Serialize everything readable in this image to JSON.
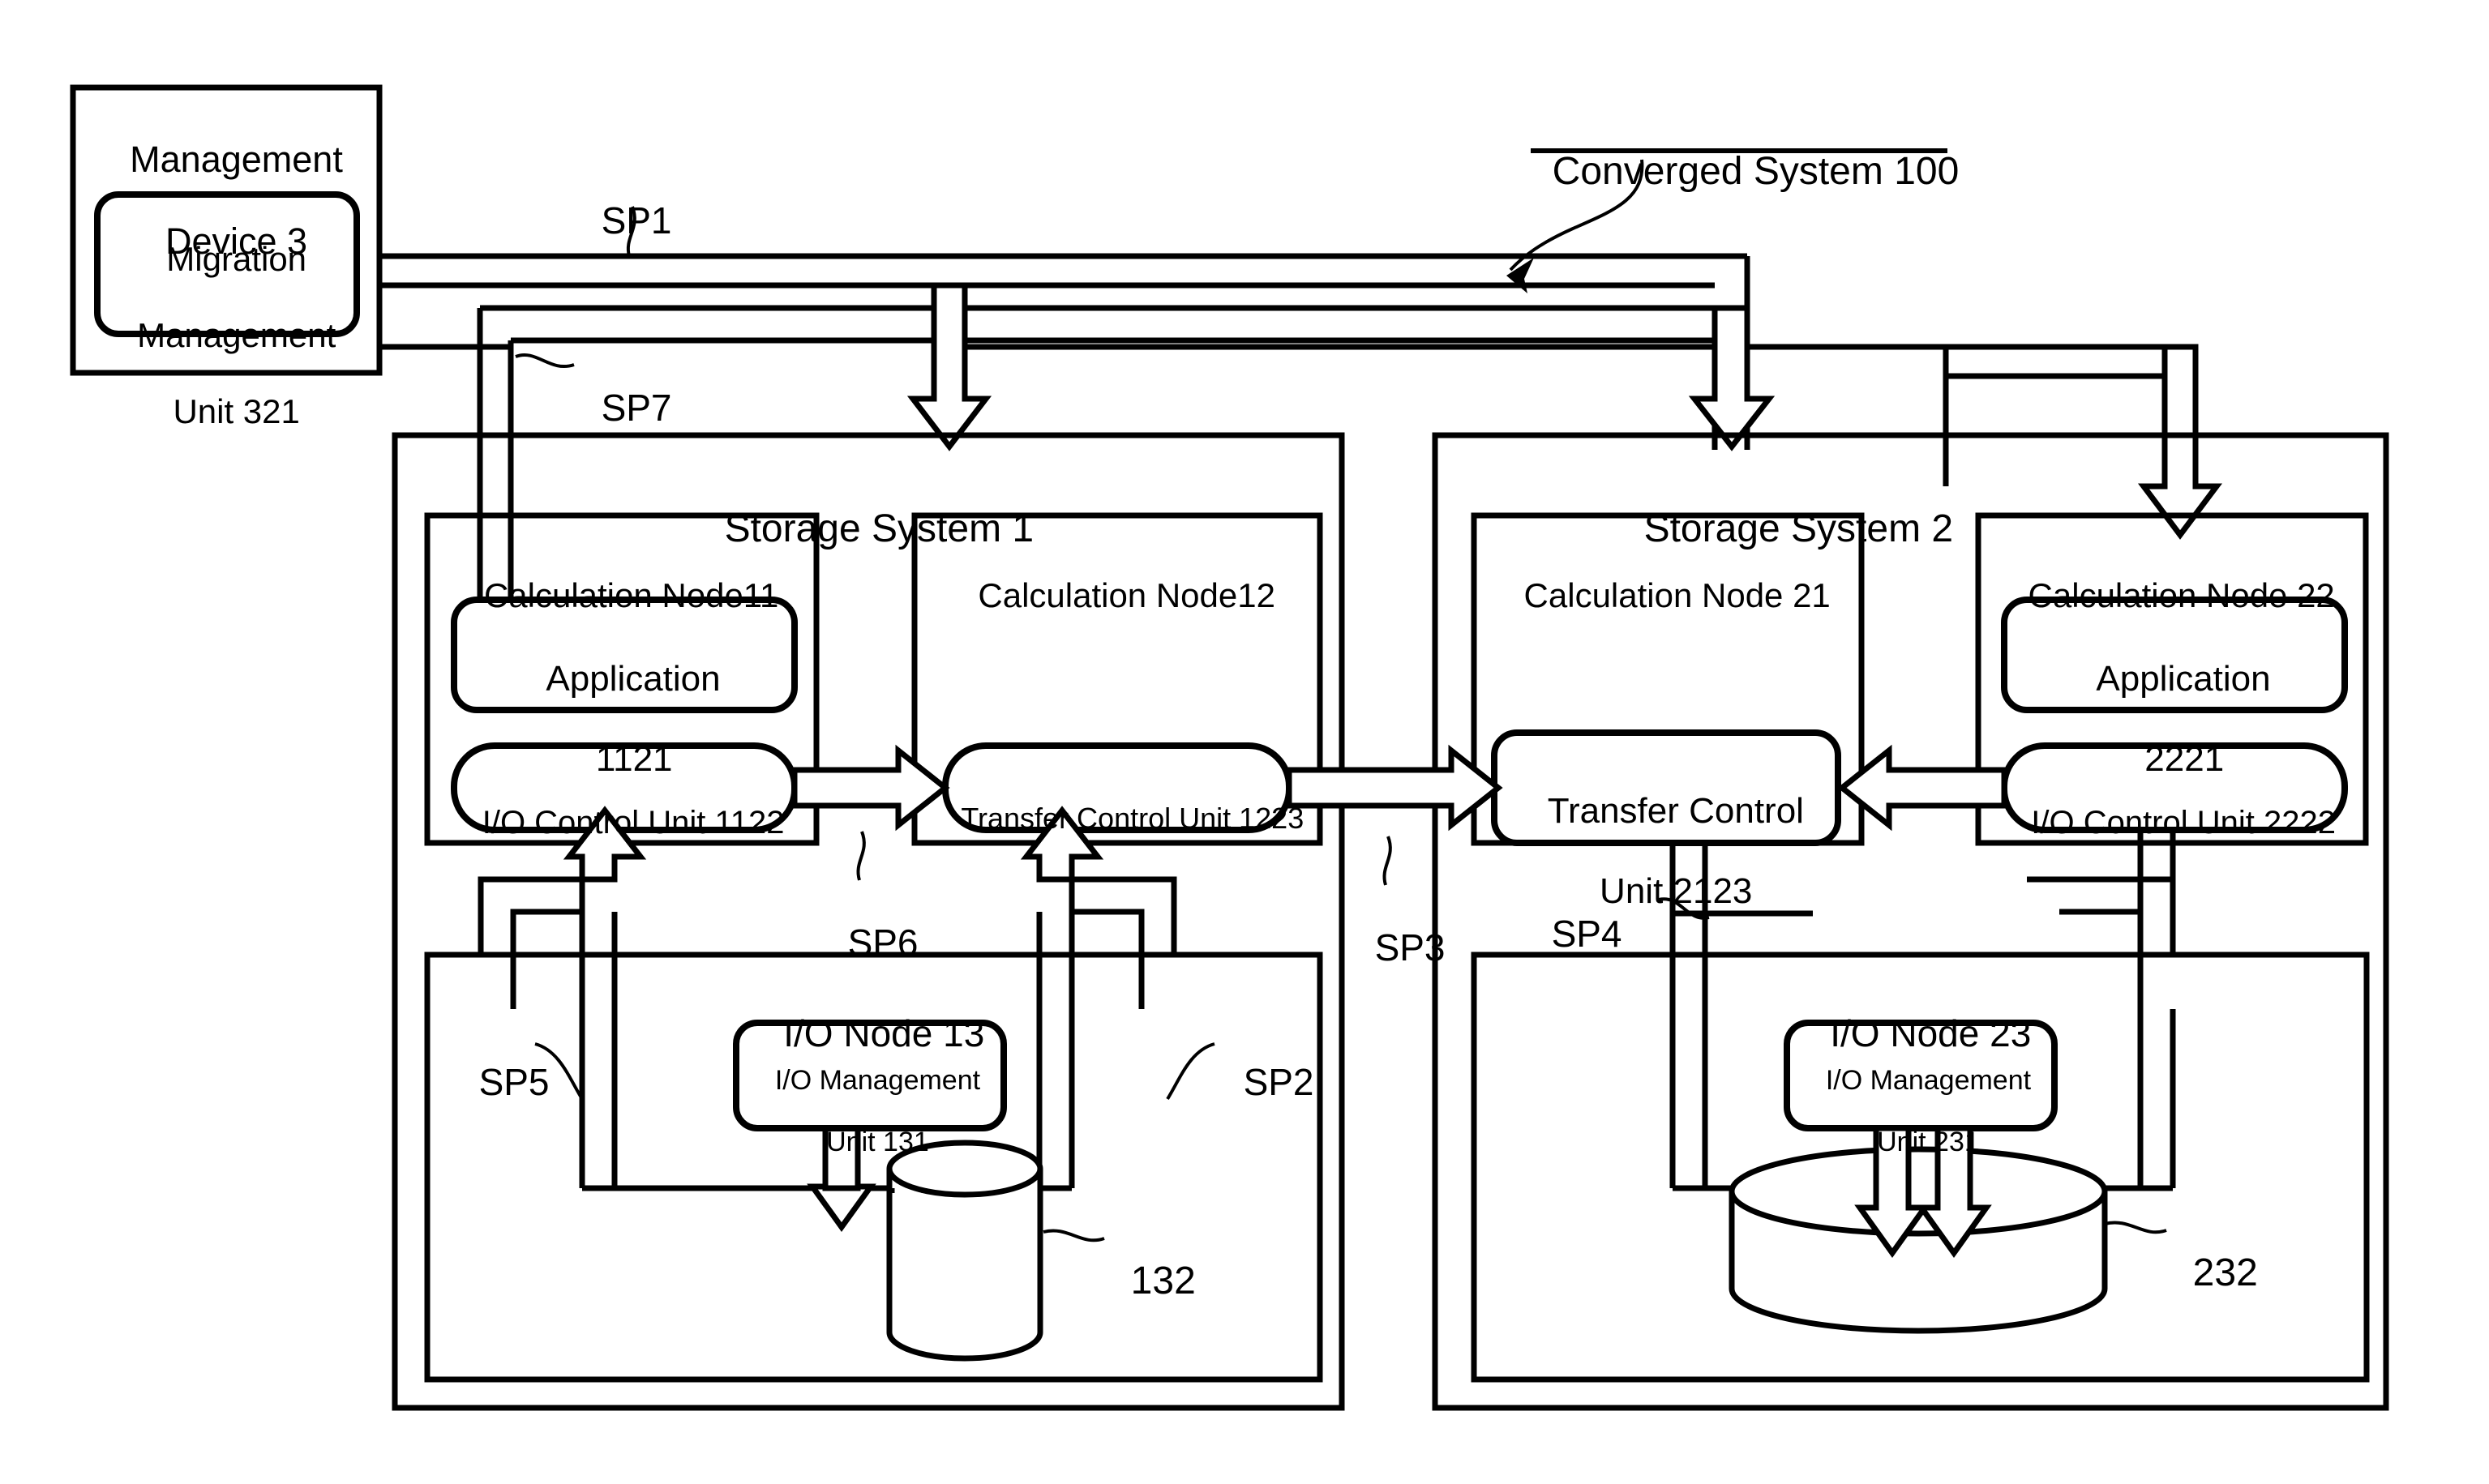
{
  "figure": {
    "type": "patent-block-diagram",
    "title_callout": "Converged System 100",
    "background": "#ffffff",
    "stroke": "#000000"
  },
  "management_device": {
    "title_line1": "Management",
    "title_line2": "Device 3",
    "unit": {
      "line1": "Migration",
      "line2": "Management",
      "line3": "Unit 321"
    }
  },
  "storage_system_1": {
    "title": "Storage System 1",
    "calculation_node_11": {
      "title": "Calculation Node11",
      "application": {
        "line1": "Application",
        "line2": "1121"
      },
      "io_control_unit": "I/O Control Unit 1122"
    },
    "calculation_node_12": {
      "title": "Calculation Node12",
      "transfer_control_unit": "Transfer Control Unit 1223"
    },
    "io_node_13": {
      "title": "I/O Node 13",
      "management_unit": {
        "line1": "I/O Management",
        "line2": "Unit 131"
      },
      "storage_ref": "132"
    }
  },
  "storage_system_2": {
    "title": "Storage System 2",
    "calculation_node_21": {
      "title": "Calculation Node 21",
      "transfer_control_unit": {
        "line1": "Transfer Control",
        "line2": "Unit 2123"
      }
    },
    "calculation_node_22": {
      "title": "Calculation Node 22",
      "application": {
        "line1": "Application",
        "line2": "2221"
      },
      "io_control_unit": "I/O Control Unit 2222"
    },
    "io_node_23": {
      "title": "I/O Node 23",
      "management_unit": {
        "line1": "I/O Management",
        "line2": "Unit 231"
      },
      "storage_ref": "232"
    }
  },
  "step_labels": {
    "sp1": "SP1",
    "sp2": "SP2",
    "sp3": "SP3",
    "sp4": "SP4",
    "sp5": "SP5",
    "sp6": "SP6",
    "sp7": "SP7"
  }
}
